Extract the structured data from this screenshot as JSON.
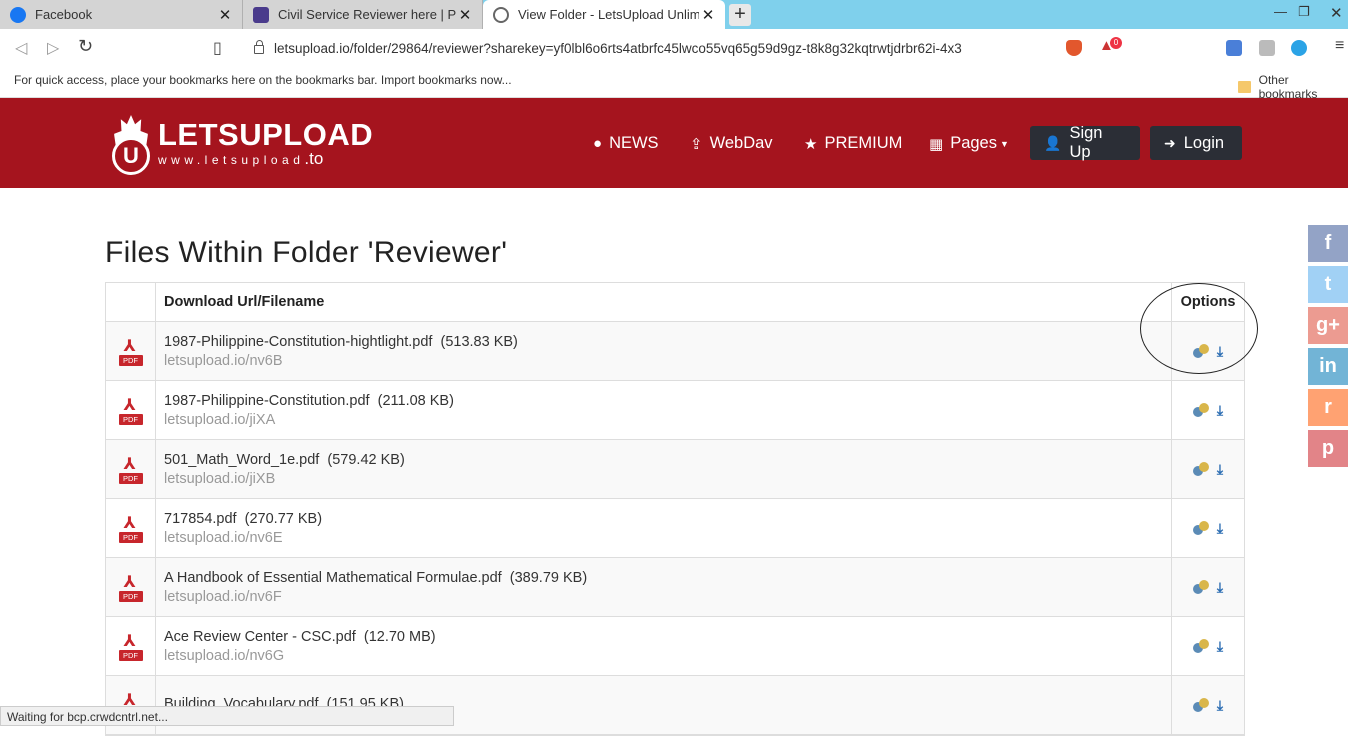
{
  "browser": {
    "tabs": [
      {
        "title": "Facebook",
        "state": "inactive",
        "icon": "facebook-icon"
      },
      {
        "title": "Civil Service Reviewer here | Pinoy",
        "state": "inactive",
        "icon": "shield-icon"
      },
      {
        "title": "View Folder - LetsUpload Unlimite",
        "state": "active",
        "icon": "globe-icon"
      }
    ],
    "url": "letsupload.io/folder/29864/reviewer?sharekey=yf0lbl6o6rts4atbrfc45lwco55vq65g59d9gz-t8k8g32kqtrwtjdrbr62i-4x3",
    "bookmarks_message": "For quick access, place your bookmarks here on the bookmarks bar.",
    "import_link": "Import bookmarks now...",
    "other_bookmarks": "Other bookmarks",
    "status_text": "Waiting for bcp.crwdcntrl.net...",
    "alert_badge": "0"
  },
  "site": {
    "logo_main": "LETSUPLOAD",
    "logo_sub": "www.letsupload",
    "logo_tld": ".to",
    "logo_letter": "U",
    "nav": {
      "news": "NEWS",
      "webdav": "WebDav",
      "premium": "PREMIUM",
      "pages": "Pages"
    },
    "signup": "Sign Up",
    "login": "Login",
    "brand_color": "#a5141e"
  },
  "folder": {
    "heading": "Files Within Folder 'Reviewer'",
    "col_filename": "Download Url/Filename",
    "col_options": "Options",
    "files": [
      {
        "name": "1987-Philippine-Constitution-hightlight.pdf",
        "size": "(513.83 KB)",
        "url": "letsupload.io/nv6B"
      },
      {
        "name": "1987-Philippine-Constitution.pdf",
        "size": "(211.08 KB)",
        "url": "letsupload.io/jiXA"
      },
      {
        "name": "501_Math_Word_1e.pdf",
        "size": "(579.42 KB)",
        "url": "letsupload.io/jiXB"
      },
      {
        "name": "717854.pdf",
        "size": "(270.77 KB)",
        "url": "letsupload.io/nv6E"
      },
      {
        "name": "A Handbook of Essential Mathematical Formulae.pdf",
        "size": "(389.79 KB)",
        "url": "letsupload.io/nv6F"
      },
      {
        "name": "Ace Review Center - CSC.pdf",
        "size": "(12.70 MB)",
        "url": "letsupload.io/nv6G"
      },
      {
        "name": "Building_Vocabulary.pdf",
        "size": "(151.95 KB)",
        "url": ""
      }
    ],
    "pdf_tag": "PDF"
  },
  "social": [
    {
      "name": "facebook",
      "glyph": "f",
      "color": "#3b5998"
    },
    {
      "name": "twitter",
      "glyph": "t",
      "color": "#55acee"
    },
    {
      "name": "google-plus",
      "glyph": "g+",
      "color": "#dd4b39"
    },
    {
      "name": "linkedin",
      "glyph": "in",
      "color": "#0077b5"
    },
    {
      "name": "reddit",
      "glyph": "r",
      "color": "#ff5700"
    },
    {
      "name": "pinterest",
      "glyph": "p",
      "color": "#cb2027"
    }
  ]
}
